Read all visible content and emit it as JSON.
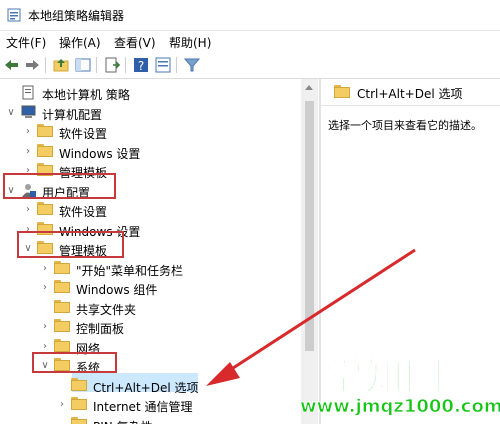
{
  "window": {
    "title": "本地组策略编辑器"
  },
  "menus": [
    "文件(F)",
    "操作(A)",
    "查看(V)",
    "帮助(H)"
  ],
  "tree": [
    {
      "label": "本地计算机 策略",
      "icon": "policy-icon",
      "toggle": ""
    },
    {
      "label": "计算机配置",
      "icon": "computer-icon",
      "toggle": "expanded"
    },
    {
      "label": "软件设置",
      "icon": "folder-icon",
      "toggle": "collapsed"
    },
    {
      "label": "Windows 设置",
      "icon": "folder-icon",
      "toggle": "collapsed"
    },
    {
      "label": "管理模板",
      "icon": "folder-icon",
      "toggle": "collapsed"
    },
    {
      "label": "用户配置",
      "icon": "user-icon",
      "toggle": "expanded"
    },
    {
      "label": "软件设置",
      "icon": "folder-icon",
      "toggle": "collapsed"
    },
    {
      "label": "Windows 设置",
      "icon": "folder-icon",
      "toggle": "collapsed"
    },
    {
      "label": "管理模板",
      "icon": "folder-icon",
      "toggle": "expanded"
    },
    {
      "label": "\"开始\"菜单和任务栏",
      "icon": "folder-icon",
      "toggle": "collapsed"
    },
    {
      "label": "Windows 组件",
      "icon": "folder-icon",
      "toggle": "collapsed"
    },
    {
      "label": "共享文件夹",
      "icon": "folder-icon",
      "toggle": ""
    },
    {
      "label": "控制面板",
      "icon": "folder-icon",
      "toggle": "collapsed"
    },
    {
      "label": "网络",
      "icon": "folder-icon",
      "toggle": "collapsed"
    },
    {
      "label": "系统",
      "icon": "folder-icon",
      "toggle": "expanded"
    },
    {
      "label": "Ctrl+Alt+Del 选项",
      "icon": "folder-icon",
      "toggle": ""
    },
    {
      "label": "Internet 通信管理",
      "icon": "folder-icon",
      "toggle": "collapsed"
    },
    {
      "label": "PIN 复杂性",
      "icon": "folder-icon",
      "toggle": ""
    }
  ],
  "right_pane": {
    "header": "Ctrl+Alt+Del 选项",
    "description": "选择一个项目来查看它的描述。"
  },
  "watermark": {
    "main": "学知网",
    "url": "www.jmqz1000.com"
  },
  "colors": {
    "highlight_box": "#c8393b",
    "selection": "#cce8ff",
    "watermark": "#14c614",
    "folder": "#f3cd62"
  }
}
